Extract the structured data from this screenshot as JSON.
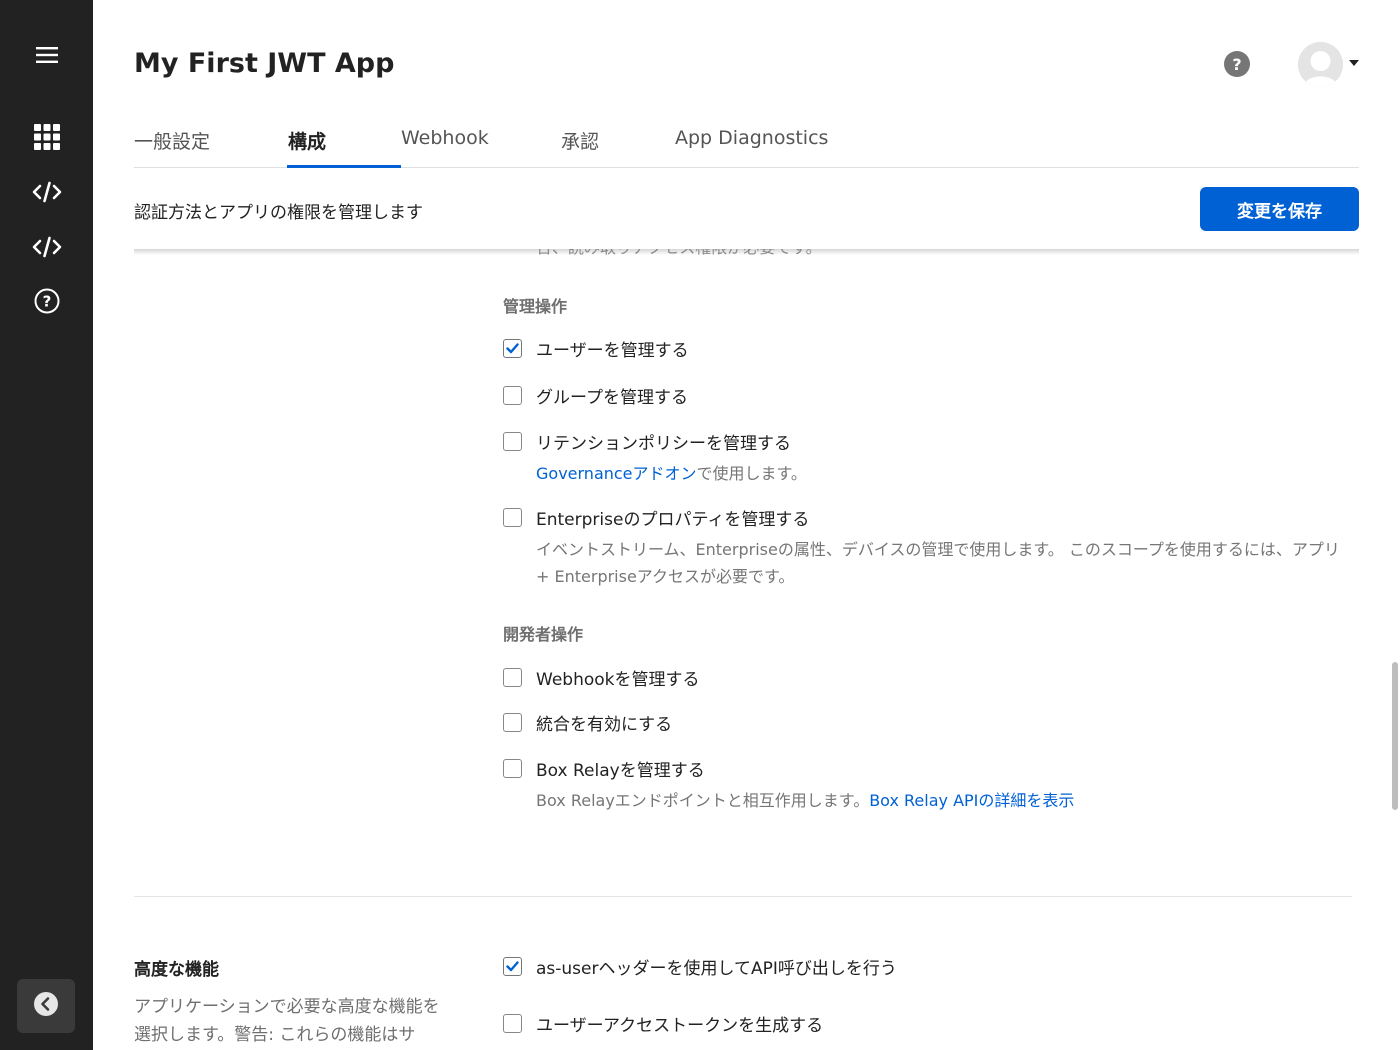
{
  "sidebar": {
    "icons": [
      "menu-icon",
      "apps-grid-icon",
      "code-icon",
      "code-icon",
      "help-circle-icon",
      "chevron-left-icon"
    ]
  },
  "header": {
    "title": "My First JWT App",
    "help_label": "?"
  },
  "tabs": [
    {
      "label": "一般設定"
    },
    {
      "label": "構成"
    },
    {
      "label": "Webhook"
    },
    {
      "label": "承認"
    },
    {
      "label": "App Diagnostics"
    }
  ],
  "subheader": {
    "description": "認証方法とアプリの権限を管理します",
    "save_label": "変更を保存"
  },
  "clipped_text": "合、読み取りアクセス権限が必要です。",
  "admin_section": {
    "title": "管理操作",
    "items": [
      {
        "label": "ユーザーを管理する",
        "checked": true
      },
      {
        "label": "グループを管理する",
        "checked": false
      },
      {
        "label": "リテンションポリシーを管理する",
        "checked": false,
        "help_link": "Governanceアドオン",
        "help_text": "で使用します。"
      },
      {
        "label": "Enterpriseのプロパティを管理する",
        "checked": false,
        "help_text": "イベントストリーム、Enterpriseの属性、デバイスの管理で使用します。 このスコープを使用するには、アプリ + Enterpriseアクセスが必要です。"
      }
    ]
  },
  "developer_section": {
    "title": "開発者操作",
    "items": [
      {
        "label": "Webhookを管理する",
        "checked": false
      },
      {
        "label": "統合を有効にする",
        "checked": false
      },
      {
        "label": "Box Relayを管理する",
        "checked": false,
        "help_text": "Box Relayエンドポイントと相互作用します。",
        "help_link": "Box Relay APIの詳細を表示"
      }
    ]
  },
  "advanced": {
    "title": "高度な機能",
    "description": "アプリケーションで必要な高度な機能を選択します。警告: これらの機能はサ",
    "items": [
      {
        "label": "as-userヘッダーを使用してAPI呼び出しを行う",
        "checked": true
      },
      {
        "label": "ユーザーアクセストークンを生成する",
        "checked": false
      }
    ]
  },
  "colors": {
    "sidebar_bg": "#222222",
    "accent": "#0061d5",
    "text": "#222222",
    "muted": "#767676"
  }
}
